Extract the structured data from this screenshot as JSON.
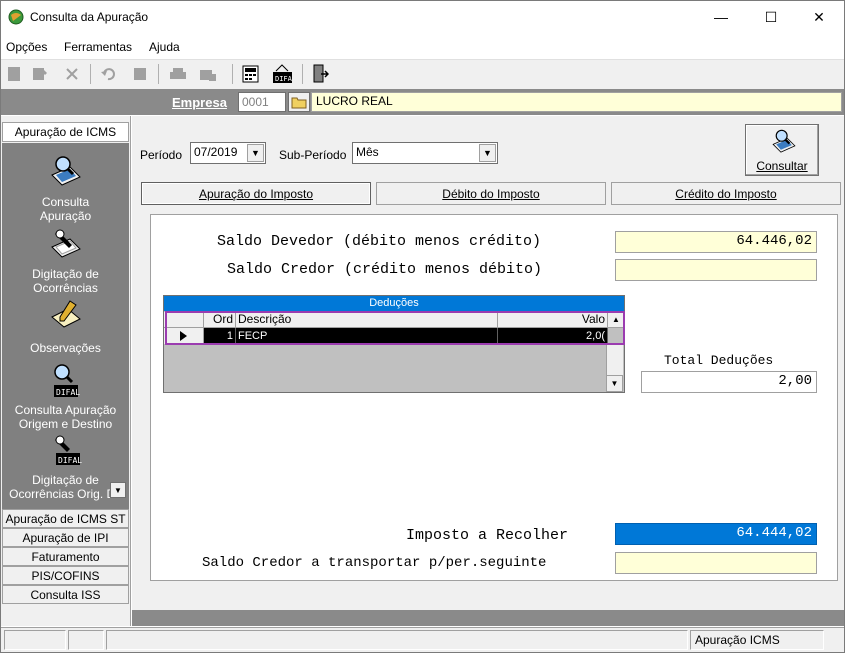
{
  "window": {
    "title": "Consulta da Apuração",
    "minimize": "—",
    "maximize": "☐",
    "close": "✕"
  },
  "menu": [
    "Opções",
    "Ferramentas",
    "Ajuda"
  ],
  "empresa": {
    "label": "Empresa",
    "code": "0001",
    "name": "LUCRO REAL"
  },
  "sidebar": {
    "header": "Apuração de ICMS",
    "entries": [
      {
        "label": "Consulta\nApuração",
        "icon": "computer-search-icon"
      },
      {
        "label": "Digitação de\nOcorrências",
        "icon": "writing-pen-icon"
      },
      {
        "label": "Observações",
        "icon": "notepad-pen-icon"
      },
      {
        "label": "Consulta Apuração\nOrigem e Destino",
        "icon": "difal-search-icon"
      },
      {
        "label": "Digitação de\nOcorrências Orig. De",
        "icon": "difal-writing-icon"
      }
    ],
    "tabs": [
      "Apuração de ICMS ST",
      "Apuração de IPI",
      "Faturamento",
      "PIS/COFINS",
      "Consulta ISS"
    ]
  },
  "filters": {
    "periodo_label": "Período",
    "periodo_value": "07/2019",
    "subperiodo_label": "Sub-Período",
    "subperiodo_value": "Mês",
    "consultar_label": "Consultar"
  },
  "tabs": [
    "Apuração do Imposto",
    "Débito do Imposto",
    "Crédito do Imposto"
  ],
  "summary": {
    "saldo_devedor_label": "Saldo Devedor (débito menos crédito)",
    "saldo_devedor_value": "64.446,02",
    "saldo_credor_label": "Saldo Credor (crédito menos débito)",
    "saldo_credor_value": "",
    "total_deducoes_label": "Total Deduções",
    "total_deducoes_value": "2,00",
    "imposto_label": "Imposto a Recolher",
    "imposto_value": "64.444,02",
    "transportar_label": "Saldo Credor a transportar p/per.seguinte",
    "transportar_value": ""
  },
  "deducoes": {
    "title": "Deduções",
    "columns": [
      "Ord",
      "Descrição",
      "Valo"
    ],
    "rows": [
      {
        "ord": "1",
        "descricao": "FECP",
        "valor": "2,0("
      }
    ]
  },
  "status": {
    "right": "Apuração ICMS"
  },
  "colors": {
    "accent_blue": "#0078d7",
    "yellow_field": "#ffffd8",
    "highlight_purple": "#9b3cb0",
    "panel_gray": "#808080"
  }
}
